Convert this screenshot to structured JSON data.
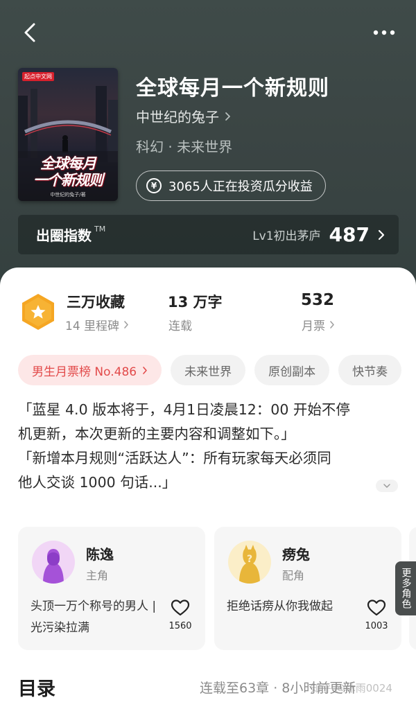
{
  "nav": {
    "back_icon": "back-arrow-icon",
    "more_icon": "more-dots-icon"
  },
  "cover": {
    "publisher": "起点中文网",
    "title_line1": "全球每月",
    "title_line2": "一个新规则",
    "author_small": "中世纪的兔子/著"
  },
  "book": {
    "title": "全球每月一个新规则",
    "author": "中世纪的兔子",
    "genre": "科幻 · 未来世界",
    "invest_text": "3065人正在投资瓜分收益"
  },
  "popularity": {
    "label": "出圈指数",
    "tm": "TM",
    "level": "Lv1初出茅庐",
    "score": "487"
  },
  "stats": {
    "collection_main": "三万收藏",
    "collection_sub": "14 里程碑",
    "words_main": "13 万字",
    "words_sub": "连载",
    "tickets_main": "532",
    "tickets_sub": "月票"
  },
  "tags": [
    "男生月票榜 No.486",
    "未来世界",
    "原创副本",
    "快节奏"
  ],
  "synopsis": {
    "line1": "「蓝星 4.0 版本将于，4月1日凌晨12：00 开始不停",
    "line2": "机更新，本次更新的主要内容和调整如下。」",
    "line3": "「新增本月规则“活跃达人”：所有玩家每天必须同",
    "line4": "他人交谈 1000 句话...」"
  },
  "characters": [
    {
      "name": "陈逸",
      "role": "主角",
      "desc": "头顶一万个称号的男人 | 光污染拉满",
      "likes": "1560"
    },
    {
      "name": "痨兔",
      "role": "配角",
      "desc": "拒绝话痨从你我做起",
      "likes": "1003"
    }
  ],
  "more_roles": "更多角色",
  "toc": {
    "title": "目录",
    "status": "连载至63章 · 8小时前更新"
  },
  "watermark": "知乎 @沐雨0024",
  "colors": {
    "header_bg": "#3e4948",
    "rank_tag_text": "#e24a4a",
    "rank_tag_bg": "#fde7e7",
    "badge": "#f5a623"
  }
}
